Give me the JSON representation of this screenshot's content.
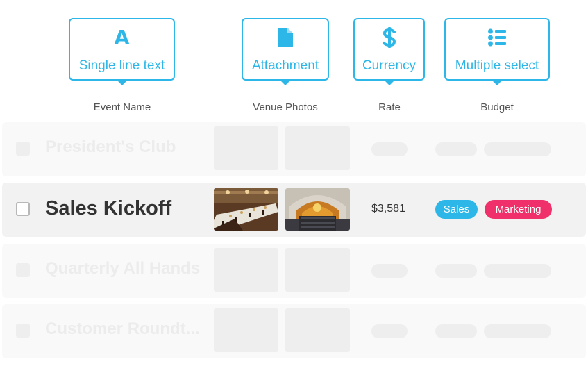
{
  "field_types": [
    {
      "label": "Single line text",
      "icon": "text-letter-icon",
      "glyph": "A"
    },
    {
      "label": "Attachment",
      "icon": "file-icon"
    },
    {
      "label": "Currency",
      "icon": "dollar-icon"
    },
    {
      "label": "Multiple select",
      "icon": "list-icon"
    }
  ],
  "columns": {
    "event_name": "Event Name",
    "venue_photos": "Venue Photos",
    "rate": "Rate",
    "budget": "Budget"
  },
  "rows": [
    {
      "title": "President's Club",
      "state": "placeholder"
    },
    {
      "title": "Sales Kickoff",
      "state": "active",
      "rate": "$3,581",
      "tags": [
        "Sales",
        "Marketing"
      ]
    },
    {
      "title": "Quarterly All Hands",
      "state": "placeholder"
    },
    {
      "title": "Customer Roundt...",
      "state": "placeholder"
    }
  ],
  "colors": {
    "accent": "#2cb7e8",
    "tag_sales": "#2cb7e8",
    "tag_marketing": "#f0306a",
    "text_dark": "#333333"
  }
}
